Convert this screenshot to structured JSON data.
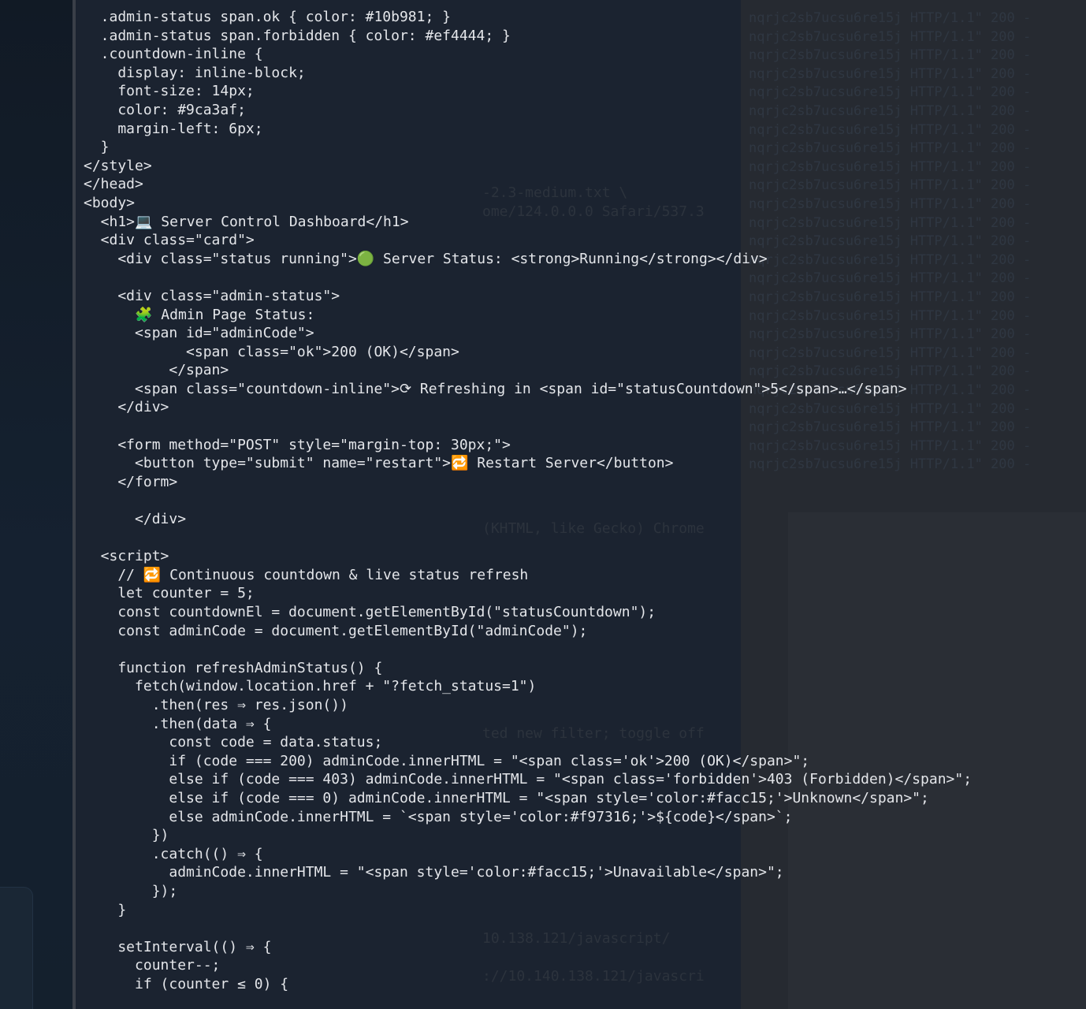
{
  "background": {
    "log_lines": [
      "nqrjc2sb7ucsu6re15j HTTP/1.1\" 200 -",
      "nqrjc2sb7ucsu6re15j HTTP/1.1\" 200 -",
      "nqrjc2sb7ucsu6re15j HTTP/1.1\" 200 -",
      "nqrjc2sb7ucsu6re15j HTTP/1.1\" 200 -",
      "nqrjc2sb7ucsu6re15j HTTP/1.1\" 200 -",
      "nqrjc2sb7ucsu6re15j HTTP/1.1\" 200 -",
      "nqrjc2sb7ucsu6re15j HTTP/1.1\" 200 -",
      "nqrjc2sb7ucsu6re15j HTTP/1.1\" 200 -",
      "nqrjc2sb7ucsu6re15j HTTP/1.1\" 200 -",
      "nqrjc2sb7ucsu6re15j HTTP/1.1\" 200 -",
      "nqrjc2sb7ucsu6re15j HTTP/1.1\" 200 -",
      "nqrjc2sb7ucsu6re15j HTTP/1.1\" 200 -",
      "nqrjc2sb7ucsu6re15j HTTP/1.1\" 200 -",
      "nqrjc2sb7ucsu6re15j HTTP/1.1\" 200 -",
      "nqrjc2sb7ucsu6re15j HTTP/1.1\" 200 -",
      "nqrjc2sb7ucsu6re15j HTTP/1.1\" 200 -",
      "nqrjc2sb7ucsu6re15j HTTP/1.1\" 200 -",
      "nqrjc2sb7ucsu6re15j HTTP/1.1\" 200 -",
      "nqrjc2sb7ucsu6re15j HTTP/1.1\" 200 -",
      "nqrjc2sb7ucsu6re15j HTTP/1.1\" 200 -",
      "nqrjc2sb7ucsu6re15j HTTP/1.1\" 200 -",
      "nqrjc2sb7ucsu6re15j HTTP/1.1\" 200 -",
      "nqrjc2sb7ucsu6re15j HTTP/1.1\" 200 -",
      "nqrjc2sb7ucsu6re15j HTTP/1.1\" 200 -",
      "nqrjc2sb7ucsu6re15j HTTP/1.1\" 200 -"
    ],
    "mid_fragments": [
      "-2.3-medium.txt \\",
      "ome/124.0.0.0 Safari/537.3",
      "(KHTML, like Gecko) Chrome",
      "ted new filter; toggle off",
      "10.138.121/javascript/",
      "://10.140.138.121/javascri"
    ]
  },
  "editor": {
    "lines": [
      "  .admin-status span.ok { color: #10b981; }",
      "  .admin-status span.forbidden { color: #ef4444; }",
      "  .countdown-inline {",
      "    display: inline-block;",
      "    font-size: 14px;",
      "    color: #9ca3af;",
      "    margin-left: 6px;",
      "  }",
      "</style>",
      "</head>",
      "<body>",
      "  <h1>💻 Server Control Dashboard</h1>",
      "  <div class=\"card\">",
      "    <div class=\"status running\">🟢 Server Status: <strong>Running</strong></div>",
      "",
      "    <div class=\"admin-status\">",
      "      🧩 Admin Page Status:",
      "      <span id=\"adminCode\">",
      "            <span class=\"ok\">200 (OK)</span>",
      "          </span>",
      "      <span class=\"countdown-inline\">⟳ Refreshing in <span id=\"statusCountdown\">5</span>…</span>",
      "    </div>",
      "",
      "    <form method=\"POST\" style=\"margin-top: 30px;\">",
      "      <button type=\"submit\" name=\"restart\">🔁 Restart Server</button>",
      "    </form>",
      "",
      "      </div>",
      "",
      "  <script>",
      "    // 🔁 Continuous countdown & live status refresh",
      "    let counter = 5;",
      "    const countdownEl = document.getElementById(\"statusCountdown\");",
      "    const adminCode = document.getElementById(\"adminCode\");",
      "",
      "    function refreshAdminStatus() {",
      "      fetch(window.location.href + \"?fetch_status=1\")",
      "        .then(res ⇒ res.json())",
      "        .then(data ⇒ {",
      "          const code = data.status;",
      "          if (code === 200) adminCode.innerHTML = \"<span class='ok'>200 (OK)</span>\";",
      "          else if (code === 403) adminCode.innerHTML = \"<span class='forbidden'>403 (Forbidden)</span>\";",
      "          else if (code === 0) adminCode.innerHTML = \"<span style='color:#facc15;'>Unknown</span>\";",
      "          else adminCode.innerHTML = `<span style='color:#f97316;'>${code}</span>`;",
      "        })",
      "        .catch(() ⇒ {",
      "          adminCode.innerHTML = \"<span style='color:#facc15;'>Unavailable</span>\";",
      "        });",
      "    }",
      "",
      "    setInterval(() ⇒ {",
      "      counter--;",
      "      if (counter ≤ 0) {"
    ]
  }
}
